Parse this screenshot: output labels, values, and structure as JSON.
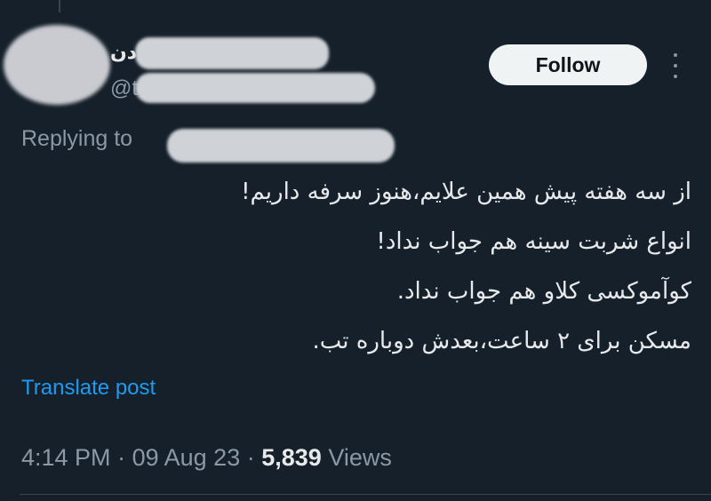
{
  "post": {
    "author_name_fragment": "دن",
    "author_handle_fragment": "@t",
    "replying_label": "Replying to",
    "follow_label": "Follow",
    "text_lines": [
      "از سه هفته پیش همین علایم،هنوز سرفه داریم!",
      "انواع شربت سینه هم جواب نداد!",
      "کوآموکسی کلاو هم جواب نداد.",
      "مسکن برای ۲ ساعت،بعدش دوباره تب."
    ],
    "translate_label": "Translate post",
    "time": "4:14 PM",
    "date": "09 Aug 23",
    "views_count": "5,839",
    "views_label": "Views",
    "separator": "·"
  },
  "icons": {
    "more": "more-vertical-icon"
  },
  "colors": {
    "background": "#15202b",
    "text": "#e7e9ea",
    "muted": "#8b98a5",
    "link": "#1d9bf0",
    "follow_bg": "#eff3f4"
  }
}
